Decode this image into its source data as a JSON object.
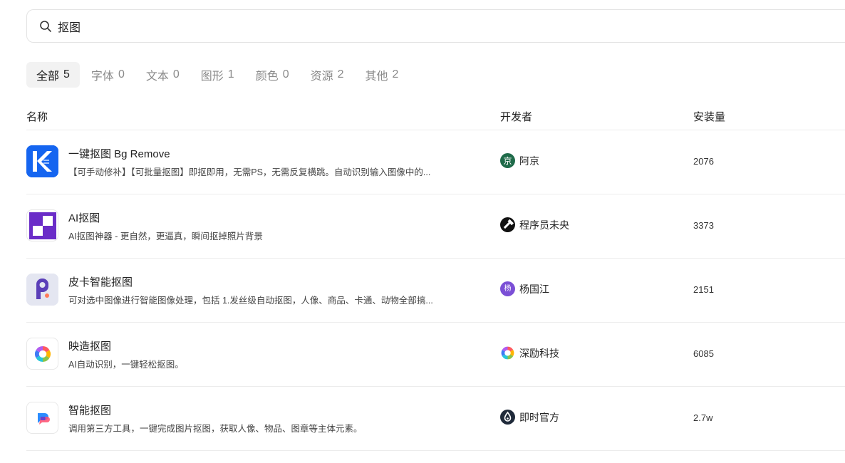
{
  "search": {
    "value": "抠图",
    "placeholder": ""
  },
  "tabs": [
    {
      "label": "全部",
      "count": "5",
      "active": true
    },
    {
      "label": "字体",
      "count": "0"
    },
    {
      "label": "文本",
      "count": "0"
    },
    {
      "label": "图形",
      "count": "1"
    },
    {
      "label": "颜色",
      "count": "0"
    },
    {
      "label": "资源",
      "count": "2"
    },
    {
      "label": "其他",
      "count": "2"
    }
  ],
  "table": {
    "headers": {
      "name": "名称",
      "developer": "开发者",
      "installs": "安装量"
    },
    "rows": [
      {
        "title": "一键抠图 Bg Remove",
        "desc": "【可手动修补】【可批量抠图】即抠即用，无需PS，无需反复横跳。自动识别输入图像中的...",
        "developer": "阿京",
        "dev_avatar_char": "京",
        "installs": "2076",
        "logo_icon": "k-logo-icon",
        "avatar_icon": "jing-avatar-icon"
      },
      {
        "title": "AI抠图",
        "desc": "AI抠图神器 - 更自然，更逼真，瞬间抠掉照片背景",
        "developer": "程序员未央",
        "installs": "3373",
        "logo_icon": "purple-checker-icon",
        "avatar_icon": "hammer-avatar-icon"
      },
      {
        "title": "皮卡智能抠图",
        "desc": "可对选中图像进行智能图像处理，包括 1.发丝级自动抠图，人像、商品、卡通、动物全部搞...",
        "developer": "杨国江",
        "dev_avatar_char": "杨",
        "installs": "2151",
        "logo_icon": "pica-logo-icon",
        "avatar_icon": "yang-avatar-icon"
      },
      {
        "title": "映造抠图",
        "desc": "AI自动识别，一键轻松抠图。",
        "developer": "深励科技",
        "installs": "6085",
        "logo_icon": "color-flower-icon",
        "avatar_icon": "color-flower-avatar-icon"
      },
      {
        "title": "智能抠图",
        "desc": "调用第三方工具，一键完成图片抠图，获取人像、物品、图章等主体元素。",
        "developer": "即时官方",
        "installs": "2.7w",
        "logo_icon": "jishi-logo-icon",
        "avatar_icon": "jishi-avatar-icon"
      }
    ]
  },
  "colors": {
    "k_blue": "#1565f0",
    "purple": "#6a2cc8",
    "jing_green": "#1f6b4a",
    "yang_purple": "#7b4fd6",
    "dark": "#222222"
  }
}
